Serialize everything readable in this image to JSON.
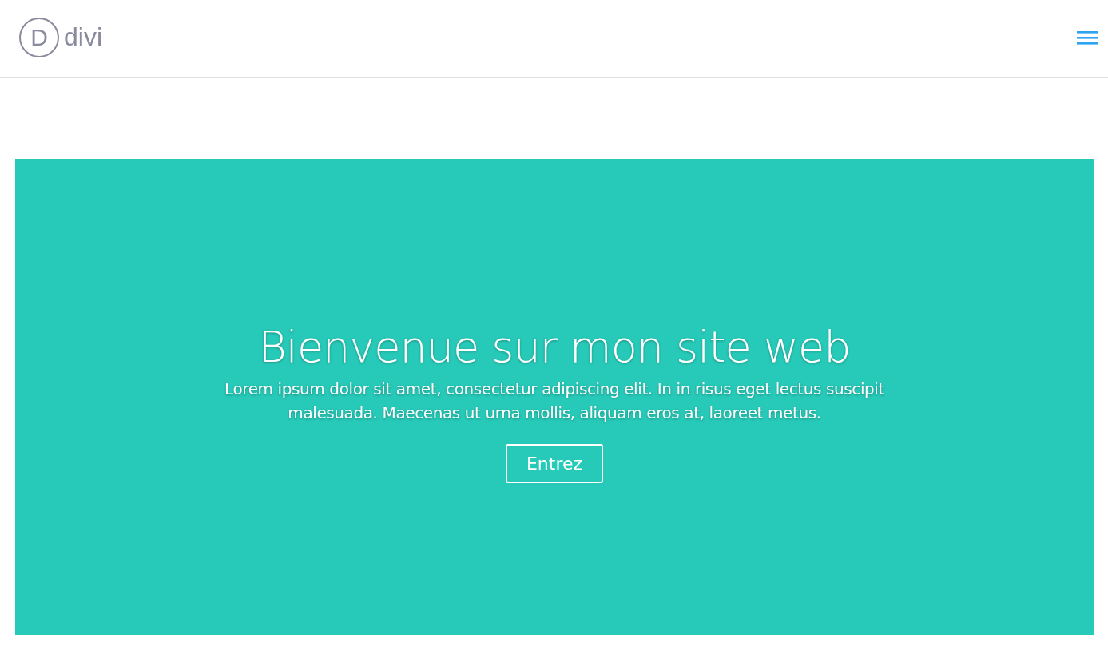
{
  "header": {
    "logo": {
      "letter": "D",
      "name": "divi"
    }
  },
  "hero": {
    "title": "Bienvenue sur mon site web",
    "text": "Lorem ipsum dolor sit amet, consectetur adipiscing elit. In in risus eget lectus suscipit malesuada. Maecenas ut urna mollis, aliquam eros at, laoreet metus.",
    "button": "Entrez"
  }
}
